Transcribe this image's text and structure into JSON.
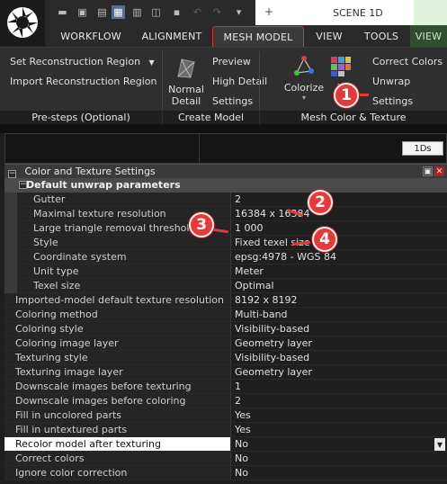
{
  "scene_tab": "SCENE 1D",
  "ribbon_tabs": [
    "WORKFLOW",
    "ALIGNMENT",
    "MESH MODEL",
    "VIEW",
    "TOOLS",
    "VIEW"
  ],
  "pre_steps": {
    "items": [
      "Set Reconstruction Region",
      "Import Reconstruction Region"
    ],
    "title": "Pre-steps (Optional)"
  },
  "create_model": {
    "normal_detail": [
      "Normal",
      "Detail"
    ],
    "items": [
      "Preview",
      "High Detail",
      "Settings"
    ],
    "title": "Create Model"
  },
  "mesh_color": {
    "colorize": "Colorize",
    "texture": "T",
    "items": [
      "Correct Colors",
      "Unwrap",
      "Settings"
    ],
    "title": "Mesh Color & Texture"
  },
  "ids_button": "1Ds",
  "panel_title": "Color and Texture Settings",
  "group_title": "Default unwrap parameters",
  "sub_rows": [
    {
      "k": "Gutter",
      "v": "2"
    },
    {
      "k": "Maximal texture resolution",
      "v": "16384 x 16384"
    },
    {
      "k": "Large triangle removal threshold",
      "v": "1 000"
    },
    {
      "k": "Style",
      "v": "Fixed texel size"
    },
    {
      "k": "Coordinate system",
      "v": "epsg:4978 - WGS 84"
    },
    {
      "k": "Unit type",
      "v": "Meter"
    },
    {
      "k": "Texel size",
      "v": "Optimal"
    }
  ],
  "rows": [
    {
      "k": "Imported-model default texture resolution",
      "v": "8192 x 8192"
    },
    {
      "k": "Coloring method",
      "v": "Multi-band"
    },
    {
      "k": "Coloring style",
      "v": "Visibility-based"
    },
    {
      "k": "Coloring image layer",
      "v": "Geometry layer"
    },
    {
      "k": "Texturing style",
      "v": "Visibility-based"
    },
    {
      "k": "Texturing image layer",
      "v": "Geometry layer"
    },
    {
      "k": "Downscale images before texturing",
      "v": "1"
    },
    {
      "k": "Downscale images before coloring",
      "v": "2"
    },
    {
      "k": "Fill in uncolored parts",
      "v": "Yes"
    },
    {
      "k": "Fill in untextured parts",
      "v": "Yes"
    },
    {
      "k": "Recolor model after texturing",
      "v": "No"
    },
    {
      "k": "Correct colors",
      "v": "No"
    },
    {
      "k": "Ignore color correction",
      "v": "No"
    }
  ],
  "markers": [
    "1",
    "2",
    "3",
    "4"
  ],
  "colors": {
    "accent_red": "#e63a3a",
    "tab_highlight": "#e03030"
  }
}
